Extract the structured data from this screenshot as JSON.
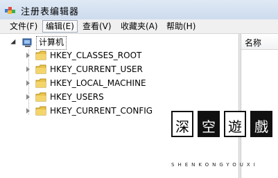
{
  "window": {
    "title": "注册表编辑器"
  },
  "menu": [
    {
      "label": "文件(F)"
    },
    {
      "label": "编辑(E)"
    },
    {
      "label": "查看(V)"
    },
    {
      "label": "收藏夹(A)"
    },
    {
      "label": "帮助(H)"
    }
  ],
  "tree": {
    "root": "计算机",
    "children": [
      {
        "label": "HKEY_CLASSES_ROOT"
      },
      {
        "label": "HKEY_CURRENT_USER"
      },
      {
        "label": "HKEY_LOCAL_MACHINE"
      },
      {
        "label": "HKEY_USERS"
      },
      {
        "label": "HKEY_CURRENT_CONFIG"
      }
    ]
  },
  "list": {
    "column_name": "名称"
  },
  "watermark": {
    "chars": [
      "深",
      "空",
      "遊",
      "戲"
    ],
    "subtitle": "SHENKONGYOUXI"
  },
  "colors": {
    "folder": "#e9c34a",
    "titlebar": "#cddbed",
    "menubar": "#f0f0f0"
  },
  "icons": {
    "app": "regedit-icon",
    "computer": "computer-icon",
    "folder": "folder-icon"
  }
}
